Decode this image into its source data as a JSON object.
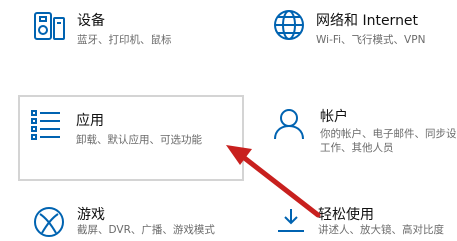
{
  "tiles": {
    "devices": {
      "title": "设备",
      "description": "蓝牙、打印机、鼠标",
      "icon": "keyboard-speaker-icon"
    },
    "network": {
      "title": "网络和 Internet",
      "description": "Wi-Fi、飞行模式、VPN",
      "icon": "globe-icon"
    },
    "apps": {
      "title": "应用",
      "description": "卸载、默认应用、可选功能",
      "icon": "apps-list-icon"
    },
    "accounts": {
      "title": "帐户",
      "description_line1": "你的帐户、电子邮件、同步设置、",
      "description_line2": "工作、其他人员",
      "icon": "person-icon"
    },
    "gaming": {
      "title": "游戏",
      "description": "截屏、DVR、广播、游戏模式",
      "icon": "xbox-icon"
    },
    "ease_of_access": {
      "title": "轻松使用",
      "description": "讲述人、放大镜、高对比度",
      "icon": "ease-of-access-icon"
    }
  },
  "colors": {
    "accent": "#0063b1",
    "arrow": "#c8201e",
    "highlight_border": "#d4d4d4"
  }
}
